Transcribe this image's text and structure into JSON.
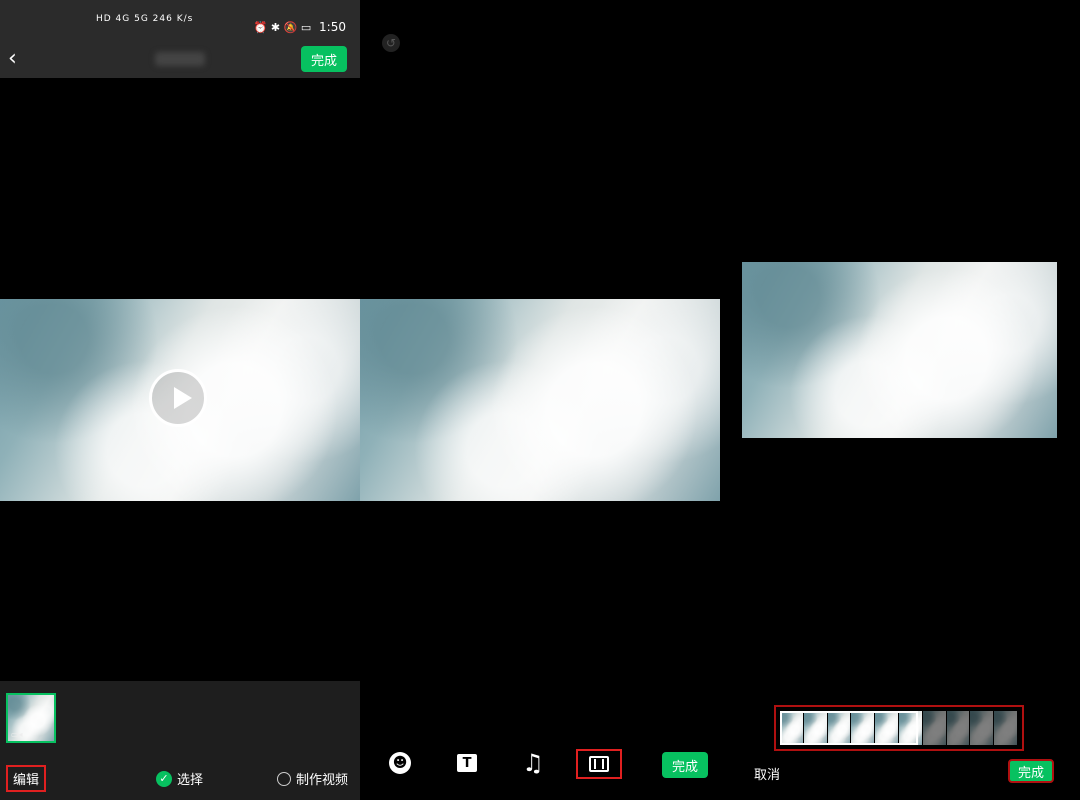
{
  "statusbar": {
    "left_text": "HD 4G 5G  246 K/s",
    "time": "1:50",
    "icons": [
      "alarm-icon",
      "bluetooth-icon",
      "mute-icon",
      "battery-icon",
      "leaf-icon"
    ]
  },
  "panel1": {
    "back_icon": "chevron-left-icon",
    "done_label": "完成",
    "edit_label": "编辑",
    "select_label": "选择",
    "make_video_label": "制作视频",
    "thumb_cam_icon": "video-camera-icon"
  },
  "panel2": {
    "tools": [
      {
        "name": "emoji-icon"
      },
      {
        "name": "text-icon",
        "glyph": "T"
      },
      {
        "name": "music-icon",
        "glyph": "♫"
      },
      {
        "name": "clip-icon"
      }
    ],
    "done_label": "完成"
  },
  "panel3": {
    "cancel_label": "取消",
    "done_label": "完成",
    "frames": 10,
    "selected_fraction": 0.58
  },
  "colors": {
    "accent": "#07c160",
    "highlight": "#e02020",
    "background": "#000000"
  }
}
